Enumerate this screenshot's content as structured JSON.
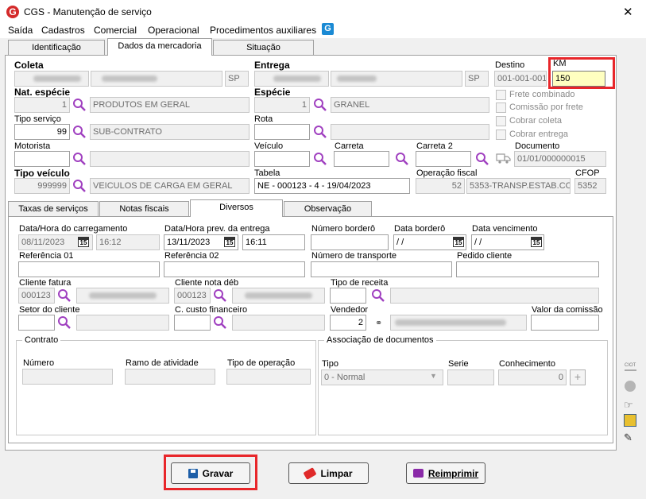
{
  "window": {
    "title": "CGS - Manutenção de serviço",
    "close_glyph": "✕"
  },
  "menu": [
    "Saída",
    "Cadastros",
    "Comercial",
    "Operacional",
    "Procedimentos auxiliares"
  ],
  "tabs_top": [
    "Identificação",
    "Dados da mercadoria",
    "Situação"
  ],
  "coleta": {
    "label": "Coleta",
    "uf": "SP"
  },
  "entrega": {
    "label": "Entrega",
    "uf": "SP"
  },
  "destino": {
    "label": "Destino",
    "value": "001-001-001"
  },
  "km": {
    "label": "KM",
    "value": "150"
  },
  "nat_especie": {
    "label": "Nat. espécie",
    "code": "1",
    "name": "PRODUTOS EM GERAL"
  },
  "especie": {
    "label": "Espécie",
    "code": "1",
    "name": "GRANEL"
  },
  "checks": [
    "Frete combinado",
    "Comissão por frete",
    "Cobrar coleta",
    "Cobrar entrega"
  ],
  "tipo_servico": {
    "label": "Tipo serviço",
    "code": "99",
    "name": "SUB-CONTRATO"
  },
  "rota": {
    "label": "Rota"
  },
  "motorista": {
    "label": "Motorista"
  },
  "veiculo": {
    "label": "Veículo"
  },
  "carreta": {
    "label": "Carreta"
  },
  "carreta2": {
    "label": "Carreta 2"
  },
  "documento": {
    "label": "Documento",
    "value": "01/01/000000015"
  },
  "tipo_veiculo": {
    "label": "Tipo veículo",
    "code": "999999",
    "name": "VEICULOS DE CARGA EM GERAL"
  },
  "tabela": {
    "label": "Tabela",
    "value": "NE - 000123 - 4 - 19/04/2023"
  },
  "operacao_fiscal": {
    "label": "Operação fiscal",
    "code": "52",
    "name": "5353-TRANSP.ESTAB.CO"
  },
  "cfop": {
    "label": "CFOP",
    "value": "5352"
  },
  "tabs_sub": [
    "Taxas de serviços",
    "Notas fiscais",
    "Diversos",
    "Observação"
  ],
  "diversos": {
    "dt_carregamento": {
      "label": "Data/Hora do carregamento",
      "date": "08/11/2023",
      "time": "16:12"
    },
    "dt_prev_entrega": {
      "label": "Data/Hora prev. da entrega",
      "date": "13/11/2023",
      "time": "16:11"
    },
    "numero_bordero": {
      "label": "Número borderô"
    },
    "data_bordero": {
      "label": "Data borderô",
      "value": " / /"
    },
    "data_vencimento": {
      "label": "Data vencimento",
      "value": " / /"
    },
    "cal_glyph": "15",
    "referencia1": {
      "label": "Referência 01"
    },
    "referencia2": {
      "label": "Referência 02"
    },
    "numero_transporte": {
      "label": "Número de transporte"
    },
    "pedido_cliente": {
      "label": "Pedido cliente"
    },
    "cliente_fatura": {
      "label": "Cliente fatura",
      "code": "000123"
    },
    "cliente_nota_deb": {
      "label": "Cliente nota déb",
      "code": "000123"
    },
    "tipo_receita": {
      "label": "Tipo de receita"
    },
    "setor_cliente": {
      "label": "Setor do cliente"
    },
    "c_custo": {
      "label": "C. custo financeiro"
    },
    "vendedor": {
      "label": "Vendedor",
      "code": "2"
    },
    "valor_comissao": {
      "label": "Valor da comissão"
    },
    "contrato": {
      "title": "Contrato",
      "numero": "Número",
      "ramo": "Ramo de atividade",
      "tipo_op": "Tipo de operação"
    },
    "assoc": {
      "title": "Associação de documentos",
      "tipo": "Tipo",
      "tipo_value": "0 - Normal",
      "serie": "Serie",
      "conhecimento": "Conhecimento",
      "conhecimento_value": "0"
    }
  },
  "side_label": "CIOT",
  "buttons": {
    "gravar": "Gravar",
    "limpar": "Limpar",
    "reimprimir": "Reimprimir"
  },
  "colors": {
    "accent": "#e8262a",
    "highlight": "#ffffc0",
    "purple": "#a040c0"
  }
}
